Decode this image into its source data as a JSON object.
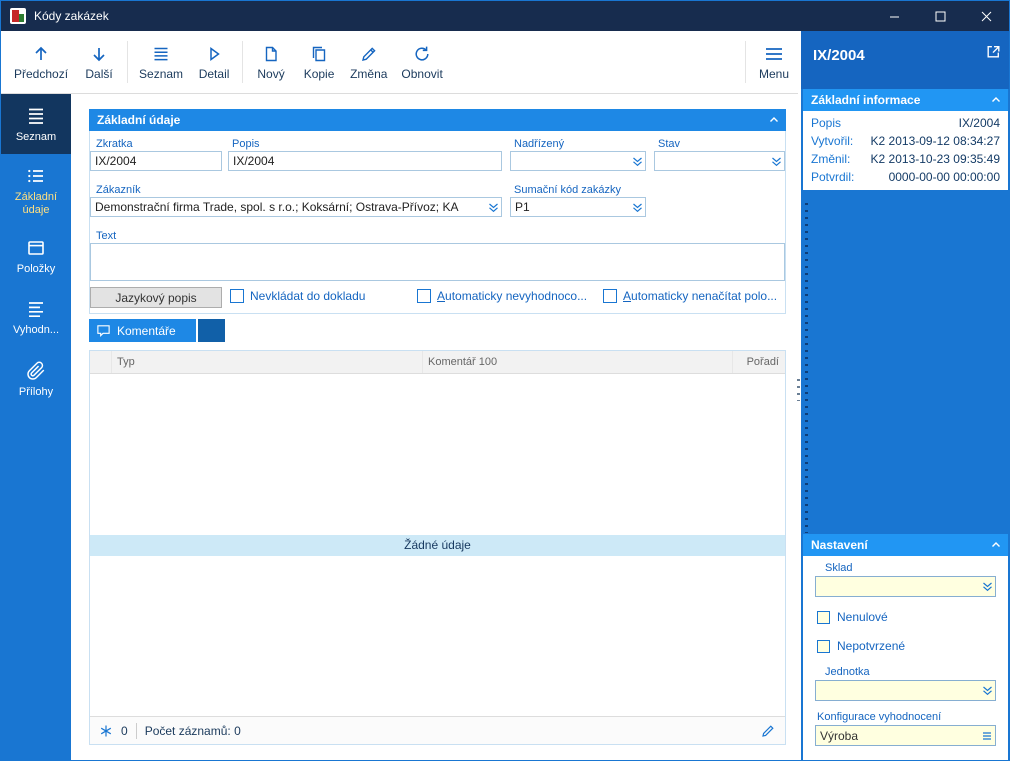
{
  "window": {
    "title": "Kódy zakázek"
  },
  "toolbar": {
    "buttons": [
      {
        "label": "Předchozí",
        "icon": "arrow-up-icon"
      },
      {
        "label": "Další",
        "icon": "arrow-down-icon"
      },
      {
        "label": "Seznam",
        "icon": "list-icon"
      },
      {
        "label": "Detail",
        "icon": "detail-play-icon"
      },
      {
        "label": "Nový",
        "icon": "new-document-icon"
      },
      {
        "label": "Kopie",
        "icon": "copy-icon"
      },
      {
        "label": "Změna",
        "icon": "edit-pencil-icon"
      },
      {
        "label": "Obnovit",
        "icon": "refresh-icon"
      }
    ],
    "menu": {
      "label": "Menu",
      "icon": "menu-icon"
    }
  },
  "sidebar": {
    "items": [
      {
        "label": "Seznam",
        "icon": "list-icon",
        "active": false
      },
      {
        "label": "Základní údaje",
        "icon": "form-list-icon",
        "active": true
      },
      {
        "label": "Položky",
        "icon": "items-panel-icon",
        "active": false
      },
      {
        "label": "Vyhodn...",
        "icon": "evaluation-list-icon",
        "active": false
      },
      {
        "label": "Přílohy",
        "icon": "paperclip-icon",
        "active": false
      }
    ]
  },
  "main": {
    "section_title": "Základní údaje",
    "form": {
      "zkratka": {
        "label": "Zkratka",
        "value": "IX/2004"
      },
      "popis": {
        "label": "Popis",
        "value": "IX/2004"
      },
      "nadrizeny": {
        "label": "Nadřízený",
        "value": ""
      },
      "stav": {
        "label": "Stav",
        "value": ""
      },
      "zakaznik": {
        "label": "Zákazník",
        "value": "Demonstrační firma Trade, spol. s r.o.; Koksární; Ostrava-Přívoz; KA"
      },
      "sumacni_kod": {
        "label": "Sumační kód zakázky",
        "value": "P1"
      },
      "text": {
        "label": "Text",
        "value": ""
      }
    },
    "jazykovy_popis_button": "Jazykový popis",
    "checkboxes": [
      {
        "label": "Nevkládat do dokladu",
        "checked": false
      },
      {
        "label": "Automaticky nevyhodnoco...",
        "checked": false
      },
      {
        "label": "Automaticky nenačítat polo...",
        "checked": false
      }
    ],
    "comments_tab": {
      "label": "Komentáře",
      "icon": "comment-icon"
    },
    "table": {
      "columns": [
        "",
        "Typ",
        "Komentář 100",
        "Pořadí"
      ],
      "rows": [],
      "empty_text": "Žádné údaje"
    },
    "statusbar": {
      "selected_count": "0",
      "records_text": "Počet záznamů: 0"
    }
  },
  "right_panel": {
    "title": "IX/2004",
    "sections": {
      "info": {
        "title": "Základní informace",
        "rows": [
          {
            "label": "Popis",
            "value": "IX/2004"
          },
          {
            "label": "Vytvořil:",
            "value": "K2 2013-09-12 08:34:27"
          },
          {
            "label": "Změnil:",
            "value": "K2 2013-10-23 09:35:49"
          },
          {
            "label": "Potvrdil:",
            "value": "0000-00-00 00:00:00"
          }
        ]
      },
      "settings": {
        "title": "Nastavení",
        "sklad": {
          "label": "Sklad",
          "value": ""
        },
        "checkboxes": [
          {
            "label": "Nenulové",
            "checked": false
          },
          {
            "label": "Nepotvrzené",
            "checked": false
          }
        ],
        "jednotka": {
          "label": "Jednotka",
          "value": ""
        },
        "konfigurace": {
          "label": "Konfigurace vyhodnocení",
          "value": "Výroba"
        }
      }
    }
  },
  "icons": {
    "dropdown-icon": "⌄⌄",
    "menu-icon": "≡",
    "paperclip-icon": "📎",
    "comment-icon": "💬",
    "selection-count-icon": "✳",
    "edit-pencil-icon": "✎",
    "external-link-icon": "↗",
    "collapse-chevron-icon": "⌃"
  },
  "colors": {
    "titlebar": "#172c4e",
    "sidebar": "#1976d2",
    "sidebar_active_item": "#12365f",
    "section_header": "#1e88e5",
    "panel_title": "#1565c0",
    "panel_section_header": "#2196f3",
    "field_yellow": "#ffffe0",
    "label_blue": "#1565c0",
    "value_navy": "#143b66",
    "empty_row_blue": "#cde9f7"
  }
}
